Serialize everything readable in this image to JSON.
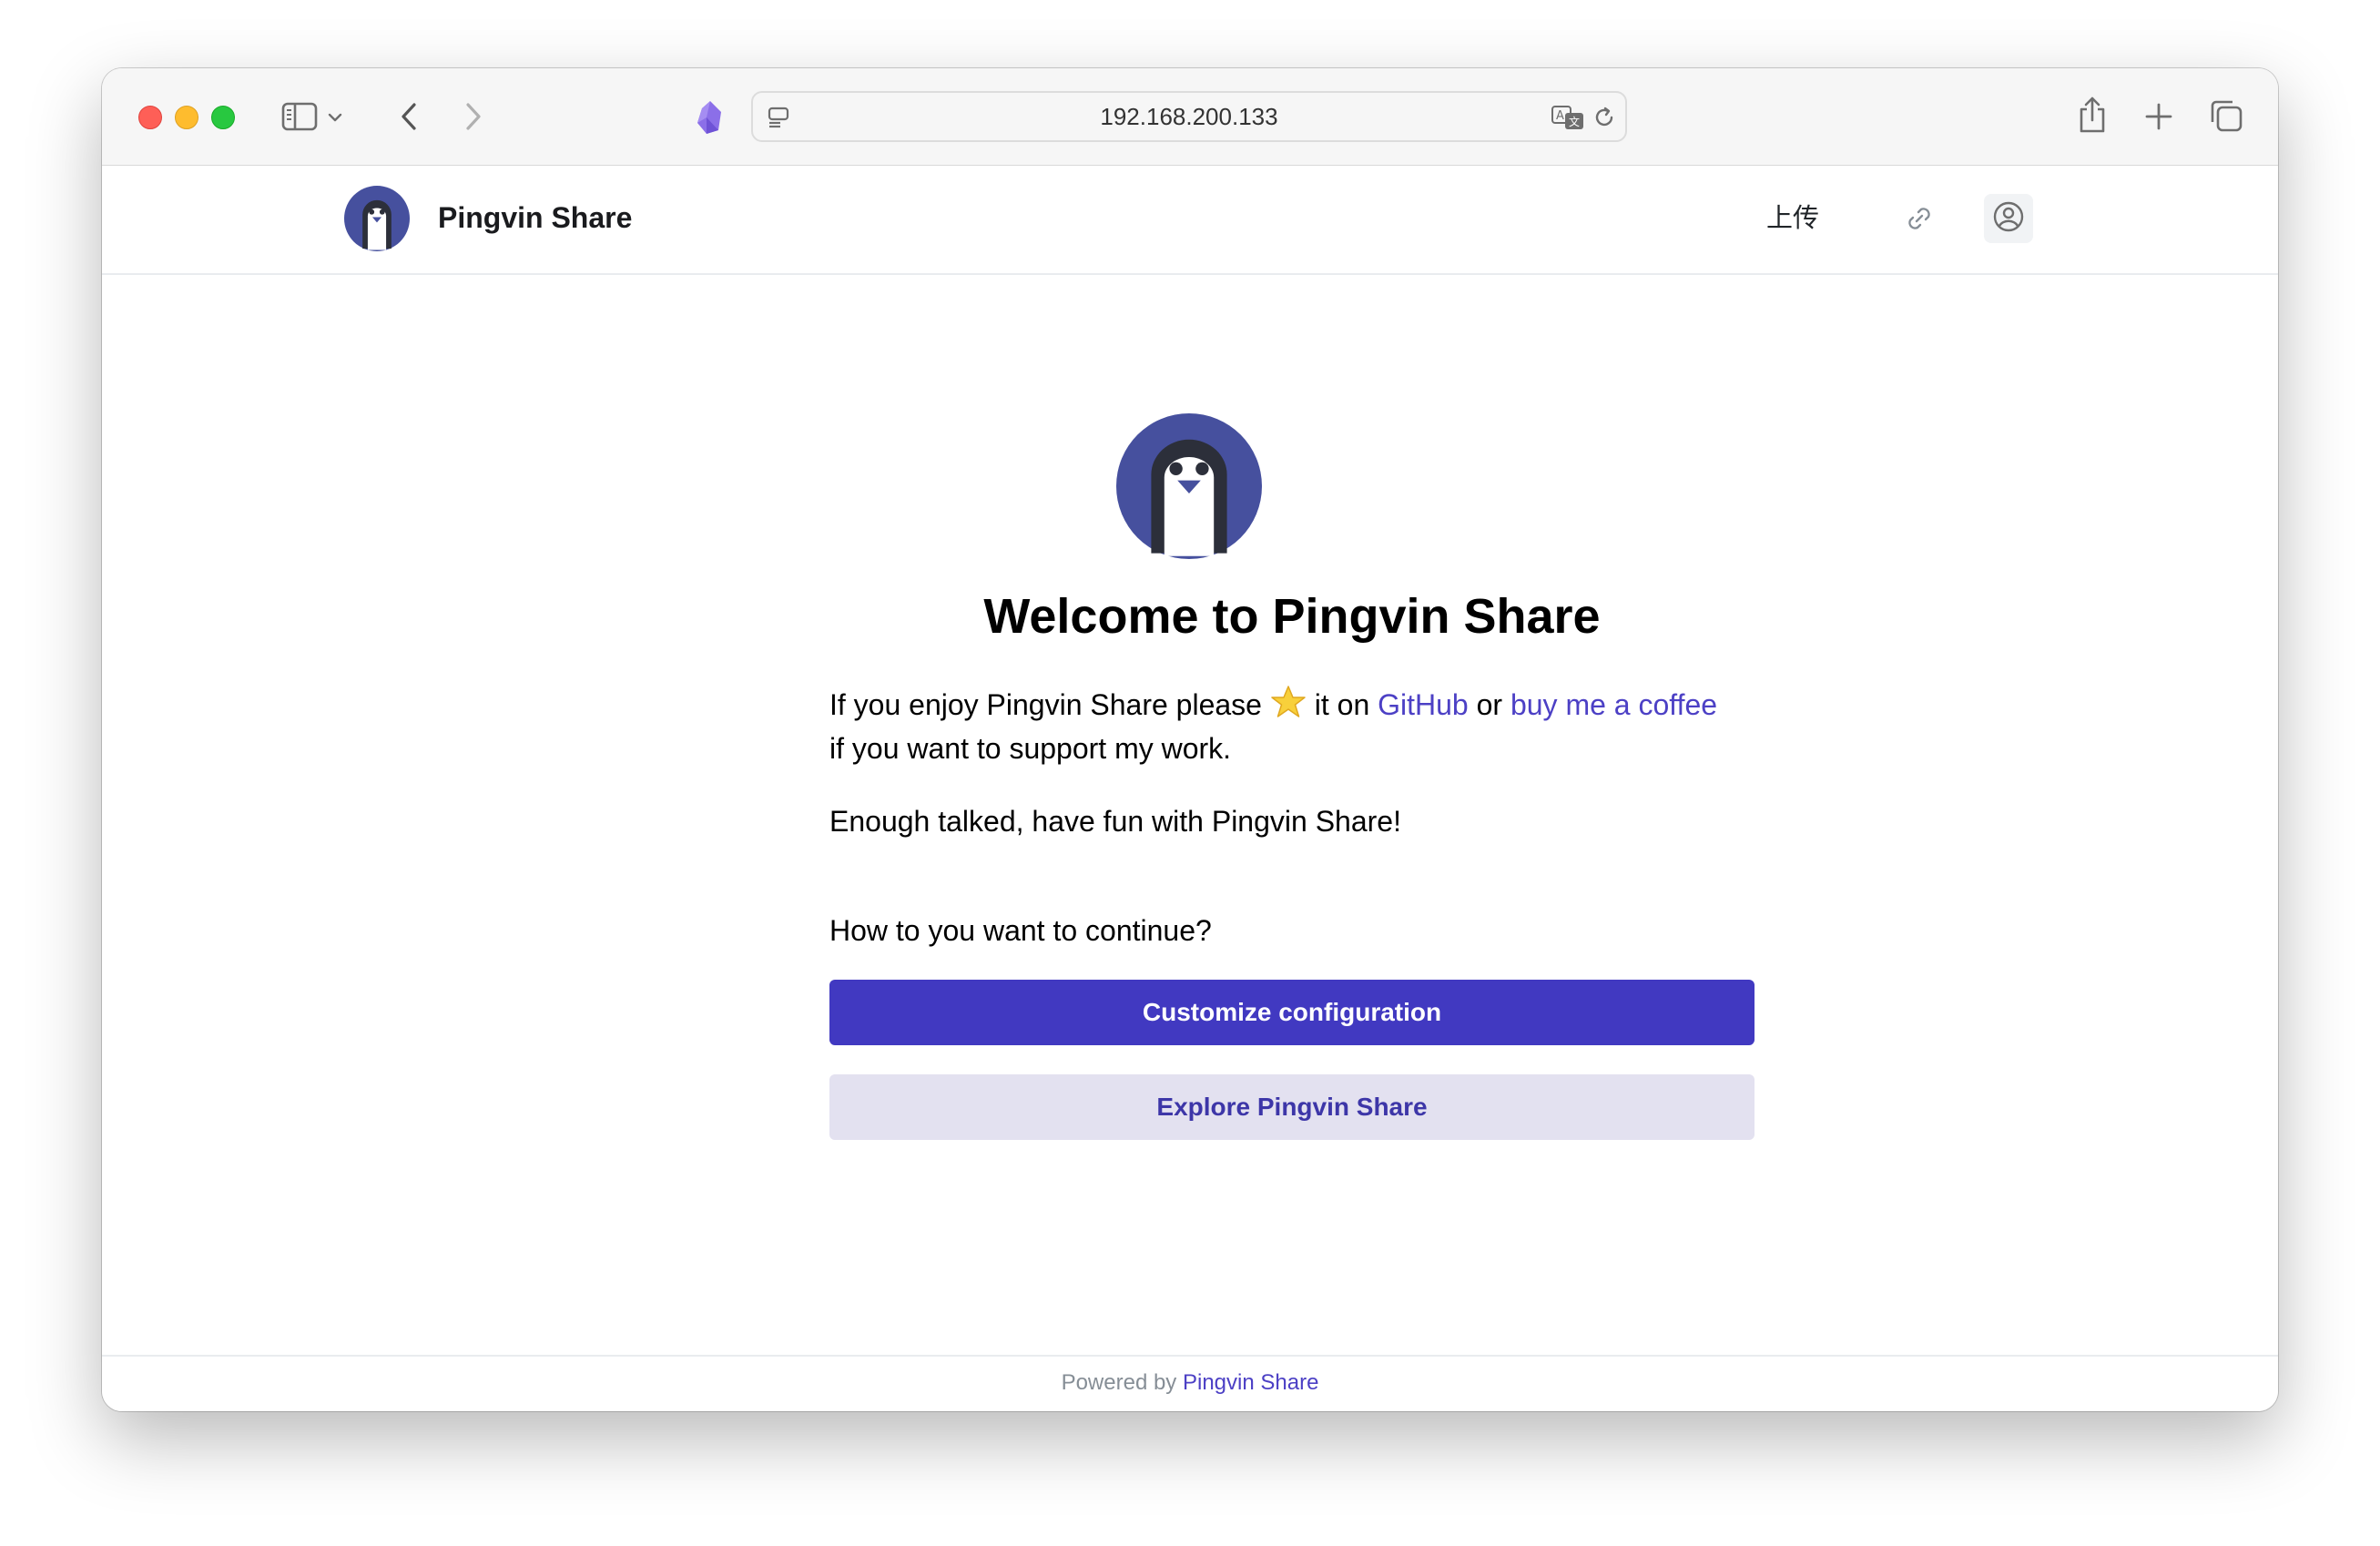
{
  "browser": {
    "address": "192.168.200.133"
  },
  "header": {
    "brand": "Pingvin Share",
    "upload_label": "上传"
  },
  "main": {
    "title": "Welcome to Pingvin Share",
    "intro_prefix": "If you enjoy Pingvin Share please",
    "intro_middle": "it on",
    "github_link": "GitHub",
    "intro_or": "or",
    "coffee_link": "buy me a coffee",
    "intro_suffix": "if you want to support my work.",
    "enough": "Enough talked, have fun with Pingvin Share!",
    "question": "How to you want to continue?",
    "customize_button": "Customize configuration",
    "explore_button": "Explore Pingvin Share"
  },
  "footer": {
    "powered_by": "Powered by",
    "powered_link": "Pingvin Share"
  },
  "colors": {
    "primary": "#4139c1",
    "secondary_bg": "#e3e1f0",
    "logo": "#46509e",
    "link": "#4c40c5"
  }
}
